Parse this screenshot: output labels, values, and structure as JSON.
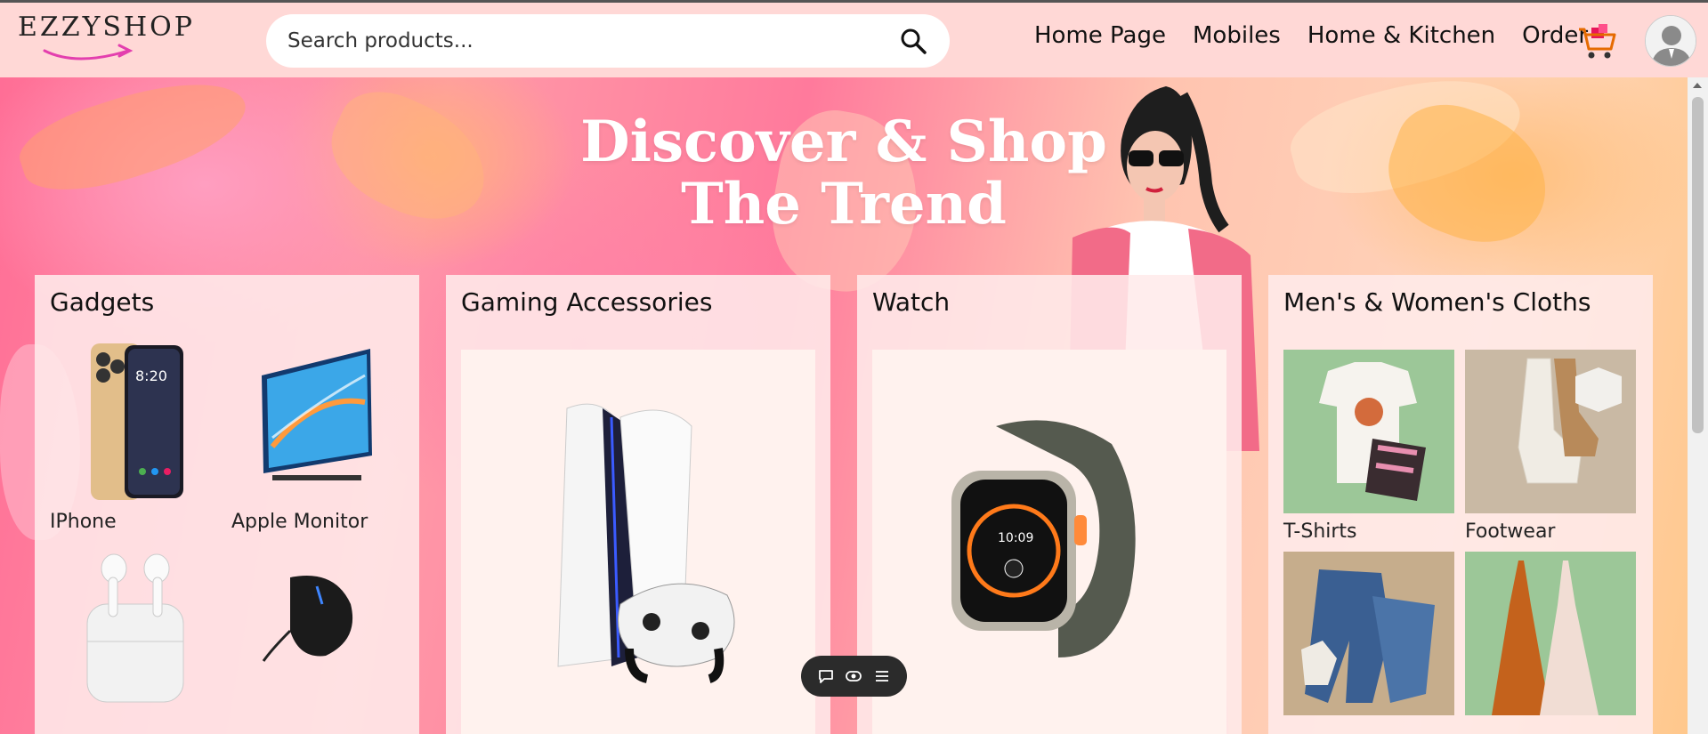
{
  "header": {
    "logo_text": "EZZYSHOP",
    "search": {
      "placeholder": "Search products..."
    },
    "nav": [
      "Home Page",
      "Mobiles",
      "Home & Kitchen",
      "Order"
    ],
    "icons": {
      "search": "search-icon",
      "cart": "cart-icon",
      "avatar": "user-avatar-icon"
    }
  },
  "hero": {
    "title_line1": "Discover & Shop",
    "title_line2": "The Trend"
  },
  "cards": {
    "gadgets": {
      "title": "Gadgets",
      "items": [
        {
          "label": "IPhone"
        },
        {
          "label": "Apple Monitor"
        },
        {
          "label": ""
        },
        {
          "label": ""
        }
      ]
    },
    "gaming": {
      "title": "Gaming Accessories"
    },
    "watch": {
      "title": "Watch"
    },
    "cloths": {
      "title": "Men's & Women's Cloths",
      "items": [
        {
          "label": "T-Shirts"
        },
        {
          "label": "Footwear"
        },
        {
          "label": ""
        },
        {
          "label": ""
        }
      ]
    }
  },
  "toolbar": {
    "icons": [
      "comment-icon",
      "eye-icon",
      "menu-icon"
    ]
  },
  "colors": {
    "header_bg": "#ffd8d6",
    "accent_pink": "#ff6e96",
    "card_bg": "#ffebeb"
  }
}
